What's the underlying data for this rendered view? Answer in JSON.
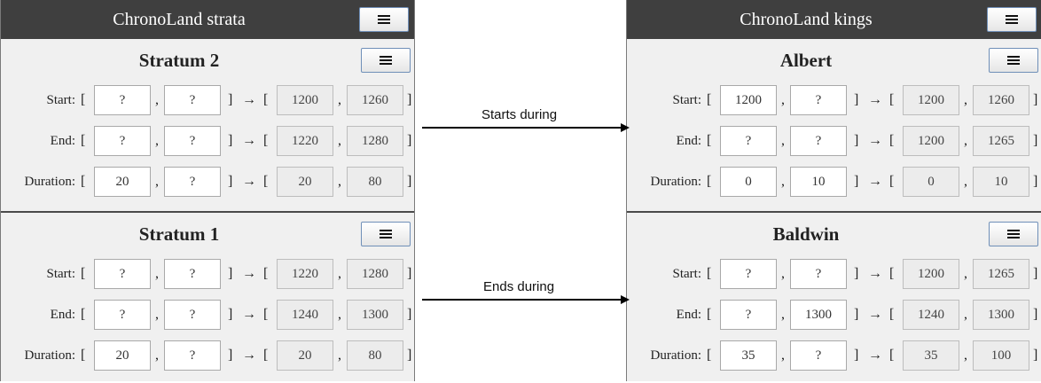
{
  "left_panel": {
    "title": "ChronoLand strata",
    "sections": [
      {
        "title": "Stratum 2",
        "rows": [
          {
            "label": "Start:",
            "in1": "?",
            "in2": "?",
            "out1": "1200",
            "out2": "1260"
          },
          {
            "label": "End:",
            "in1": "?",
            "in2": "?",
            "out1": "1220",
            "out2": "1280"
          },
          {
            "label": "Duration:",
            "in1": "20",
            "in2": "?",
            "out1": "20",
            "out2": "80"
          }
        ]
      },
      {
        "title": "Stratum 1",
        "rows": [
          {
            "label": "Start:",
            "in1": "?",
            "in2": "?",
            "out1": "1220",
            "out2": "1280"
          },
          {
            "label": "End:",
            "in1": "?",
            "in2": "?",
            "out1": "1240",
            "out2": "1300"
          },
          {
            "label": "Duration:",
            "in1": "20",
            "in2": "?",
            "out1": "20",
            "out2": "80"
          }
        ]
      }
    ]
  },
  "right_panel": {
    "title": "ChronoLand kings",
    "sections": [
      {
        "title": "Albert",
        "rows": [
          {
            "label": "Start:",
            "in1": "1200",
            "in2": "?",
            "out1": "1200",
            "out2": "1260"
          },
          {
            "label": "End:",
            "in1": "?",
            "in2": "?",
            "out1": "1200",
            "out2": "1265"
          },
          {
            "label": "Duration:",
            "in1": "0",
            "in2": "10",
            "out1": "0",
            "out2": "10"
          }
        ]
      },
      {
        "title": "Baldwin",
        "rows": [
          {
            "label": "Start:",
            "in1": "?",
            "in2": "?",
            "out1": "1200",
            "out2": "1265"
          },
          {
            "label": "End:",
            "in1": "?",
            "in2": "1300",
            "out1": "1240",
            "out2": "1300"
          },
          {
            "label": "Duration:",
            "in1": "35",
            "in2": "?",
            "out1": "35",
            "out2": "100"
          }
        ]
      }
    ]
  },
  "symbols": {
    "open": "[",
    "comma": ",",
    "close": "]",
    "arrow": "→"
  },
  "relations": [
    {
      "label": "Starts during"
    },
    {
      "label": "Ends during"
    }
  ],
  "icons": {
    "menu": "hamburger-menu-icon"
  }
}
